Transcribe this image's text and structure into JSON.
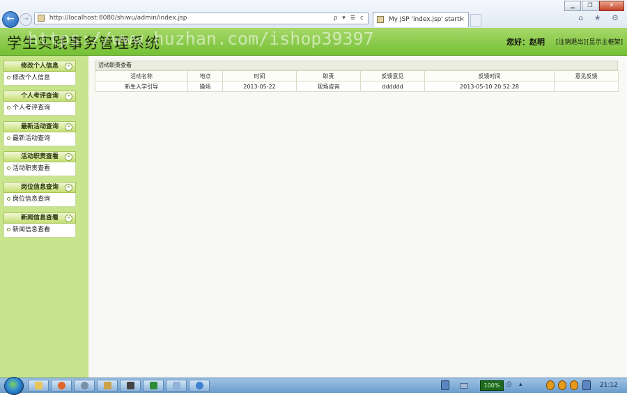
{
  "browser": {
    "url": "http://localhost:8080/shiwu/admin/index.jsp",
    "tab_title": "My JSP 'index.jsp' startin...",
    "tab_close": "×",
    "search_tools": "ρ ▾ ≣ c",
    "back_glyph": "←",
    "forward_glyph": "→",
    "window_controls": {
      "minimize": "▁",
      "maximize": "❐",
      "close": "✕"
    },
    "command_icons": "⌂ ★ ⚙"
  },
  "header": {
    "title": "学生实践事务管理系统",
    "watermark": "https://www.huzhan.com/ishop39397",
    "greeting": "您好：赵明",
    "logout": "[注销退出]",
    "home": "[显示主框架]"
  },
  "sidebar": {
    "groups": [
      {
        "title": "修改个人信息",
        "item": "修改个人信息"
      },
      {
        "title": "个人考评查询",
        "item": "个人考评查询"
      },
      {
        "title": "最新活动查询",
        "item": "最新活动查询"
      },
      {
        "title": "活动职责查看",
        "item": "活动职责查看"
      },
      {
        "title": "岗位信息查询",
        "item": "岗位信息查询"
      },
      {
        "title": "新闻信息查看",
        "item": "新闻信息查看"
      }
    ]
  },
  "main": {
    "panel_title": "活动职责查看",
    "columns": [
      "活动名称",
      "地点",
      "时间",
      "职责",
      "反馈意见",
      "反馈时间",
      "意见反馈"
    ],
    "rows": [
      [
        "新生入学引导",
        "操场",
        "2013-05-22",
        "现场咨询",
        "dddddd",
        "2013-05-10 20:52:28",
        ""
      ]
    ]
  },
  "taskbar": {
    "battery": "100%",
    "tray": "⎙ ▴",
    "clock": "21:12"
  },
  "colors": {
    "header_green": "#8ccb4e",
    "sidebar_green": "#c8e48c",
    "menu_head": "#d6ea94",
    "taskbar_blue": "#7fa9d4"
  }
}
